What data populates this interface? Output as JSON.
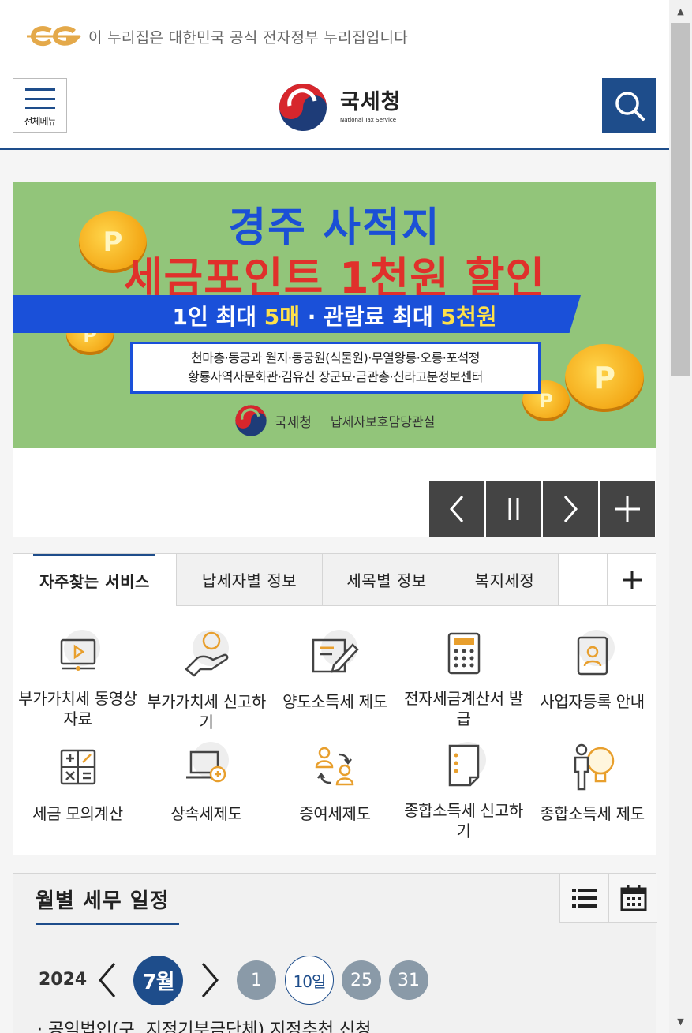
{
  "gov_banner": {
    "text": "이 누리집은 대한민국 공식 전자정부 누리집입니다",
    "logo_name": "eg-logo"
  },
  "header": {
    "menu_label": "전체메뉴",
    "logo_kr": "국세청",
    "logo_en": "National Tax Service",
    "search_icon": "search-icon",
    "accent_color": "#1e4d8b"
  },
  "banner": {
    "title1": "경주 사적지",
    "title2": "세금포인트 1천원 할인",
    "stripe_pre": "1인 최대 ",
    "stripe_hl1": "5매",
    "stripe_mid": " · 관람료 최대 ",
    "stripe_hl2": "5천원",
    "places_line1": "천마총·동궁과 월지·동궁원(식물원)·무열왕릉·오릉·포석정",
    "places_line2": "황룡사역사문화관·김유신 장군묘·금관총·신라고분정보센터",
    "footer_org": "국세청",
    "footer_dept": "납세자보호담당관실",
    "coin_letter": "P",
    "bg_color": "#92c57a",
    "controls": [
      "prev-icon",
      "pause-icon",
      "next-icon",
      "plus-icon"
    ]
  },
  "services": {
    "tabs": [
      {
        "label": "자주찾는 서비스",
        "active": true
      },
      {
        "label": "납세자별 정보",
        "active": false
      },
      {
        "label": "세목별 정보",
        "active": false
      },
      {
        "label": "복지세정",
        "active": false
      }
    ],
    "more_icon": "plus-icon",
    "items": [
      {
        "label": "부가가치세 동영상자료",
        "icon": "video-monitor-icon"
      },
      {
        "label": "부가가치세 신고하기",
        "icon": "hand-person-icon"
      },
      {
        "label": "양도소득세 제도",
        "icon": "document-pen-icon"
      },
      {
        "label": "전자세금계산서 발급",
        "icon": "calculator-icon"
      },
      {
        "label": "사업자등록 안내",
        "icon": "id-card-icon"
      },
      {
        "label": "세금 모의계산",
        "icon": "math-calculator-icon"
      },
      {
        "label": "상속세제도",
        "icon": "laptop-plus-icon"
      },
      {
        "label": "증여세제도",
        "icon": "transfer-people-icon"
      },
      {
        "label": "종합소득세 신고하기",
        "icon": "checklist-icon"
      },
      {
        "label": "종합소득세 제도",
        "icon": "person-bulb-icon"
      }
    ]
  },
  "schedule": {
    "title": "월별 세무 일정",
    "view_icons": [
      "list-icon",
      "calendar-icon"
    ],
    "year": "2024",
    "month": "7월",
    "days": [
      "1",
      "10일",
      "25",
      "31"
    ],
    "selected_day": "10일",
    "first_item": "공익법인(구. 지정기부금단체) 지정추천 신청"
  }
}
